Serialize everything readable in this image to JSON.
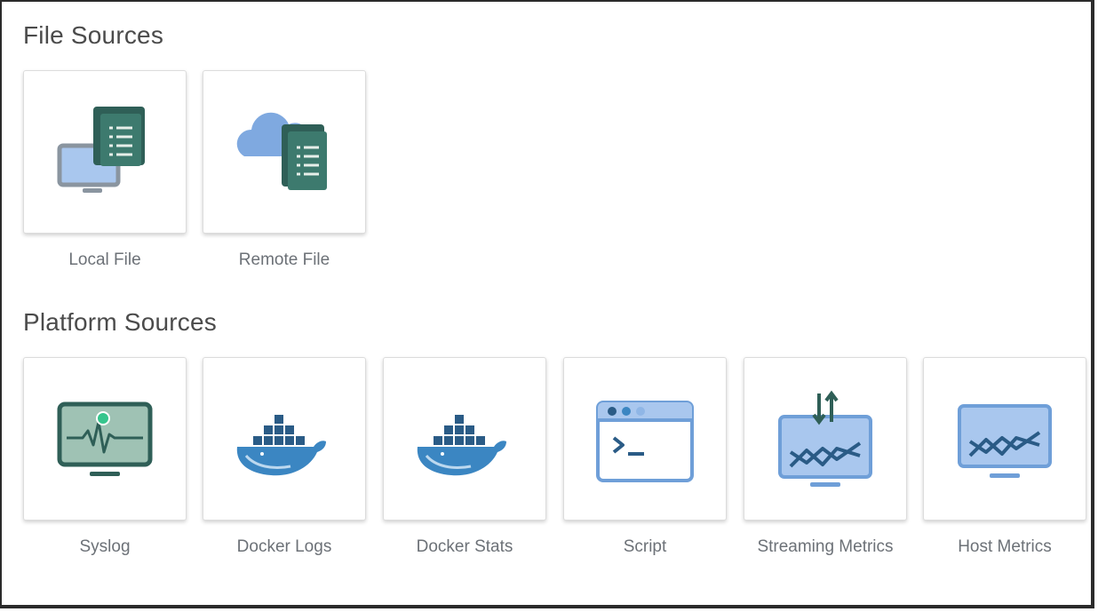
{
  "sections": [
    {
      "title": "File Sources",
      "items": [
        {
          "label": "Local File",
          "icon": "local-file-icon"
        },
        {
          "label": "Remote File",
          "icon": "remote-file-icon"
        }
      ]
    },
    {
      "title": "Platform Sources",
      "items": [
        {
          "label": "Syslog",
          "icon": "syslog-icon"
        },
        {
          "label": "Docker Logs",
          "icon": "docker-icon"
        },
        {
          "label": "Docker Stats",
          "icon": "docker-icon"
        },
        {
          "label": "Script",
          "icon": "script-icon"
        },
        {
          "label": "Streaming Metrics",
          "icon": "streaming-metrics-icon"
        },
        {
          "label": "Host Metrics",
          "icon": "host-metrics-icon"
        }
      ]
    }
  ],
  "colors": {
    "dark_teal": "#2f5f57",
    "light_blue": "#a9c7ee",
    "mid_blue": "#6f9fd8",
    "docker_blue": "#3b86c2",
    "docker_dark": "#2a5b86"
  }
}
